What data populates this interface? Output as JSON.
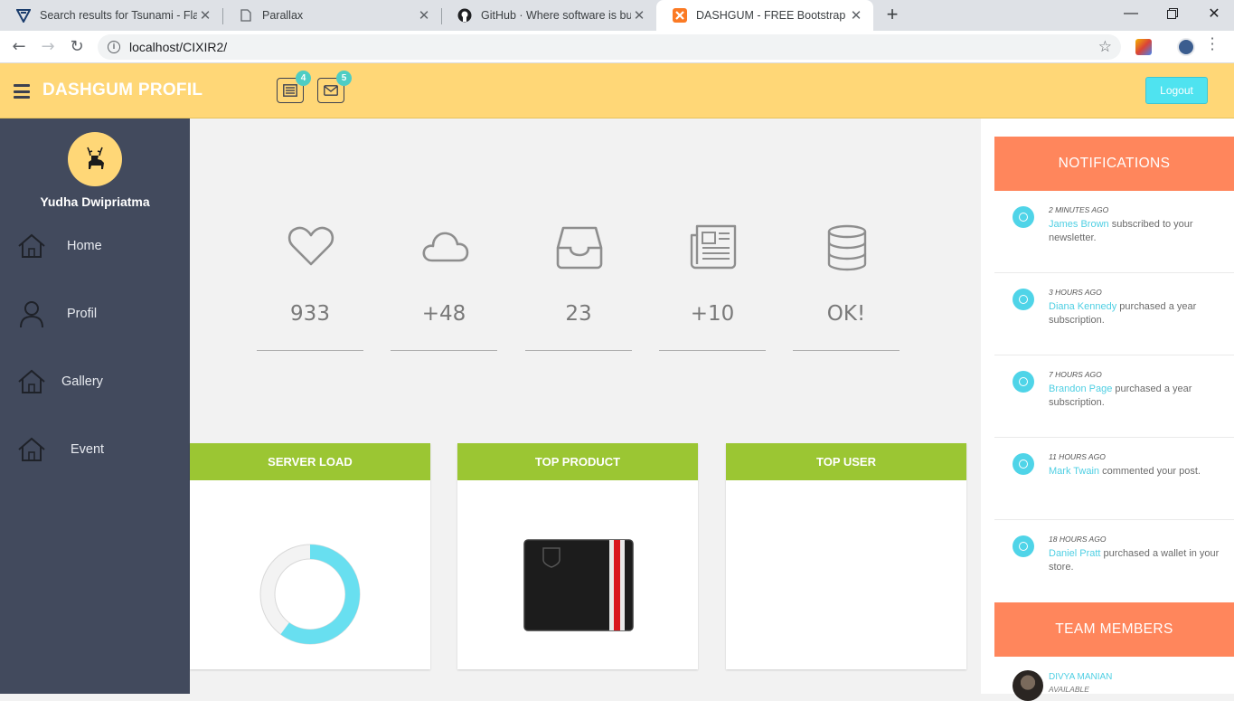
{
  "browser": {
    "tabs": [
      {
        "title": "Search results for Tsunami - Flatic",
        "icon": "flaticon-icon"
      },
      {
        "title": "Parallax",
        "icon": "page-icon"
      },
      {
        "title": "GitHub · Where software is built",
        "icon": "github-icon"
      },
      {
        "title": "DASHGUM - FREE Bootstrap Adm",
        "icon": "xampp-icon"
      }
    ],
    "url": "localhost/CIXIR2/"
  },
  "header": {
    "logo": "DASHGUM PROFIL",
    "tasks_badge": "4",
    "mail_badge": "5",
    "logout_label": "Logout"
  },
  "sidebar": {
    "user_name": "Yudha Dwipriatma",
    "items": [
      {
        "label": "Home",
        "icon": "home-icon"
      },
      {
        "label": "Profil",
        "icon": "user-icon"
      },
      {
        "label": "Gallery",
        "icon": "home-icon"
      },
      {
        "label": "Event",
        "icon": "home-icon"
      }
    ]
  },
  "stats": [
    {
      "icon": "heart-icon",
      "value": "933"
    },
    {
      "icon": "cloud-icon",
      "value": "+48"
    },
    {
      "icon": "inbox-icon",
      "value": "23"
    },
    {
      "icon": "newspaper-icon",
      "value": "+10"
    },
    {
      "icon": "database-icon",
      "value": "OK!"
    }
  ],
  "panels": {
    "server_load": {
      "title": "SERVER LOAD",
      "load_fraction": 0.6
    },
    "top_product": {
      "title": "TOP PRODUCT"
    },
    "top_user": {
      "title": "TOP USER"
    }
  },
  "notifications": {
    "title": "NOTIFICATIONS",
    "items": [
      {
        "time": "2 Minutes Ago",
        "who": "James Brown",
        "text": " subscribed to your newsletter."
      },
      {
        "time": "3 Hours Ago",
        "who": "Diana Kennedy",
        "text": " purchased a year subscription."
      },
      {
        "time": "7 Hours Ago",
        "who": "Brandon Page",
        "text": " purchased a year subscription."
      },
      {
        "time": "11 Hours Ago",
        "who": "Mark Twain",
        "text": " commented your post."
      },
      {
        "time": "18 Hours Ago",
        "who": "Daniel Pratt",
        "text": " purchased a wallet in your store."
      }
    ]
  },
  "team": {
    "title": "TEAM MEMBERS",
    "members": [
      {
        "name": "DIVYA MANIAN",
        "status": "Available"
      }
    ]
  },
  "colors": {
    "header_bg": "#ffd777",
    "sidebar_bg": "#424a5d",
    "panel_head": "#9bc633",
    "section_head": "#ff865c",
    "accent_cyan": "#4fe3f0"
  }
}
